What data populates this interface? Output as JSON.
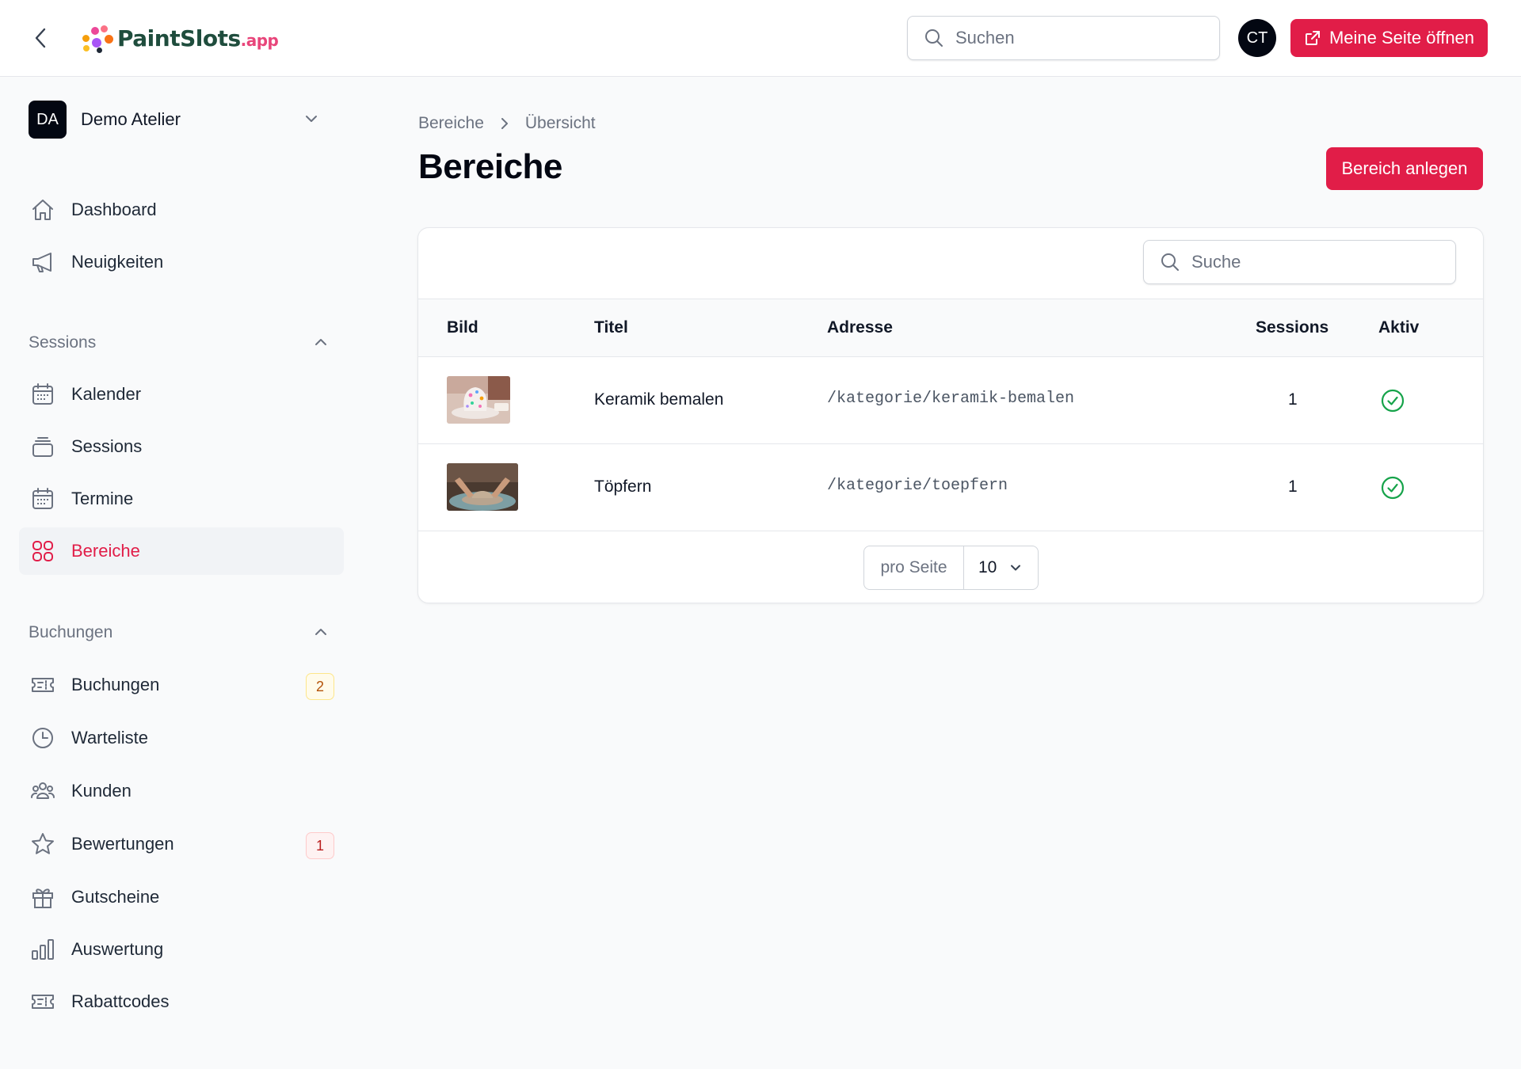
{
  "header": {
    "logo_main": "PaintSlots",
    "logo_suffix": ".app",
    "search_placeholder": "Suchen",
    "avatar_initials": "CT",
    "open_page_label": "Meine Seite öffnen"
  },
  "sidebar": {
    "tenant_initials": "DA",
    "tenant_name": "Demo Atelier",
    "top_items": [
      {
        "label": "Dashboard",
        "icon": "home-icon"
      },
      {
        "label": "Neuigkeiten",
        "icon": "megaphone-icon"
      }
    ],
    "groups": [
      {
        "title": "Sessions",
        "items": [
          {
            "label": "Kalender",
            "icon": "calendar-icon"
          },
          {
            "label": "Sessions",
            "icon": "stack-icon"
          },
          {
            "label": "Termine",
            "icon": "calendar-icon"
          },
          {
            "label": "Bereiche",
            "icon": "grid-icon",
            "active": true
          }
        ]
      },
      {
        "title": "Buchungen",
        "items": [
          {
            "label": "Buchungen",
            "icon": "ticket-icon",
            "badge": "2"
          },
          {
            "label": "Warteliste",
            "icon": "clock-icon"
          },
          {
            "label": "Kunden",
            "icon": "users-icon"
          },
          {
            "label": "Bewertungen",
            "icon": "star-icon",
            "badge": "1"
          },
          {
            "label": "Gutscheine",
            "icon": "gift-icon"
          },
          {
            "label": "Auswertung",
            "icon": "bar-chart-icon"
          },
          {
            "label": "Rabattcodes",
            "icon": "ticket-icon"
          }
        ]
      }
    ]
  },
  "breadcrumb": [
    "Bereiche",
    "Übersicht"
  ],
  "page": {
    "title": "Bereiche",
    "create_label": "Bereich anlegen"
  },
  "table": {
    "search_placeholder": "Suche",
    "columns": [
      "Bild",
      "Titel",
      "Adresse",
      "Sessions",
      "Aktiv"
    ],
    "rows": [
      {
        "title": "Keramik bemalen",
        "address": "/kategorie/keramik-bemalen",
        "sessions": "1",
        "active": true
      },
      {
        "title": "Töpfern",
        "address": "/kategorie/toepfern",
        "sessions": "1",
        "active": true
      }
    ],
    "per_page_label": "pro Seite",
    "per_page_value": "10"
  },
  "colors": {
    "accent": "#e11d48",
    "success": "#16a34a"
  }
}
